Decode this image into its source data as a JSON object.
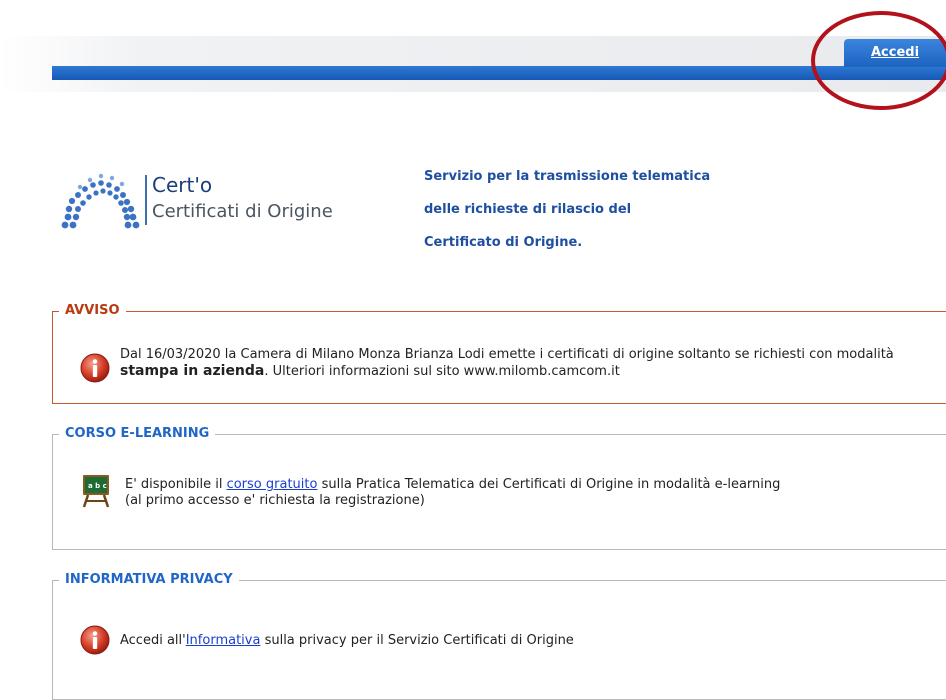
{
  "header": {
    "login_tab_label": "Accedi"
  },
  "logo": {
    "title": "Cert'o",
    "subtitle": "Certificati di Origine"
  },
  "service": {
    "lines": [
      "Servizio per la trasmissione telematica",
      "delle richieste di rilascio del",
      "Certificato di Origine."
    ]
  },
  "avviso": {
    "legend": "AVVISO",
    "line1": "Dal 16/03/2020 la Camera di Milano Monza Brianza Lodi emette i certificati di origine soltanto se richiesti con modalità",
    "line2_bold": "stampa in azienda",
    "line2_rest": ". Ulteriori informazioni sul sito www.milomb.camcom.it"
  },
  "corso": {
    "legend": "CORSO E-LEARNING",
    "line1_before": "E' disponibile il ",
    "line1_link": "corso gratuito",
    "line1_after": " sulla Pratica Telematica dei Certificati di Origine in modalità e-learning",
    "line2": "(al primo accesso e' richiesta la registrazione)"
  },
  "privacy": {
    "legend": "INFORMATIVA PRIVACY",
    "text_before": "Accedi all'",
    "link": "Informativa",
    "text_after": " sulla privacy per il Servizio Certificati di Origine"
  },
  "colors": {
    "header_blue": "#1559b5",
    "highlight_red": "#b2121b",
    "avviso_orange": "#b73a10",
    "legend_blue": "#1f66c8",
    "service_blue": "#1f4fa0"
  },
  "icons": {
    "logo": "certo-dots-arc-logo",
    "info": "info-icon",
    "elearning": "blackboard-icon"
  }
}
